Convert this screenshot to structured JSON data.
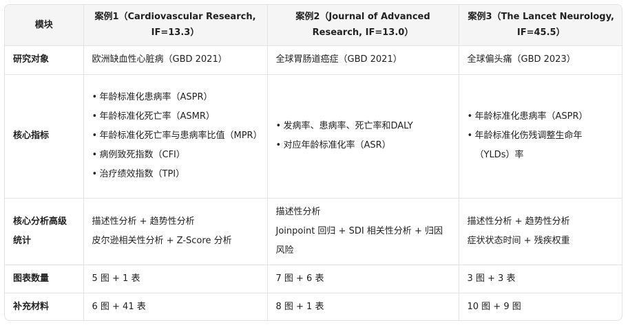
{
  "headers": [
    "模块",
    "案例1（Cardiovascular Research, IF=13.3）",
    "案例2（Journal of Advanced Research, IF=13.0）",
    "案例3（The Lancet Neurology, IF=45.5）"
  ],
  "rows": [
    {
      "label": "研究对象",
      "c1": "欧洲缺血性心脏病（GBD 2021）",
      "c2": "全球胃肠道癌症（GBD 2021）",
      "c3": "全球偏头痛（GBD 2023）"
    },
    {
      "label": "核心指标",
      "c1": [
        "年龄标准化患病率（ASPR）",
        "年龄标准化死亡率（ASMR）",
        "年龄标准化死亡率与患病率比值（MPR）",
        "病例致死指数（CFI）",
        "治疗绩效指数（TPI）"
      ],
      "c2": [
        "发病率、患病率、死亡率和DALY",
        "对应年龄标准化率（ASR）"
      ],
      "c3": [
        "年龄标准化患病率（ASPR）",
        "年龄标准化伤残调整生命年（YLDs）率"
      ]
    },
    {
      "label": "核心分析高级统计",
      "c1": [
        "描述性分析 + 趋势性分析",
        "皮尔逊相关性分析 + Z-Score 分析"
      ],
      "c2": [
        "描述性分析",
        "Joinpoint 回归 + SDI 相关性分析 + 归因风险"
      ],
      "c3": [
        "描述性分析 + 趋势性分析",
        "症状状态时间 + 残疾权重"
      ]
    },
    {
      "label": "图表数量",
      "c1": "5 图 + 1 表",
      "c2": "7 图 + 6 表",
      "c3": "3 图 + 3 表"
    },
    {
      "label": "补充材料",
      "c1": "6 图 + 41 表",
      "c2": "8 图 + 1 表",
      "c3": "10 图 + 9 图"
    }
  ],
  "bullet_glyph": "•"
}
